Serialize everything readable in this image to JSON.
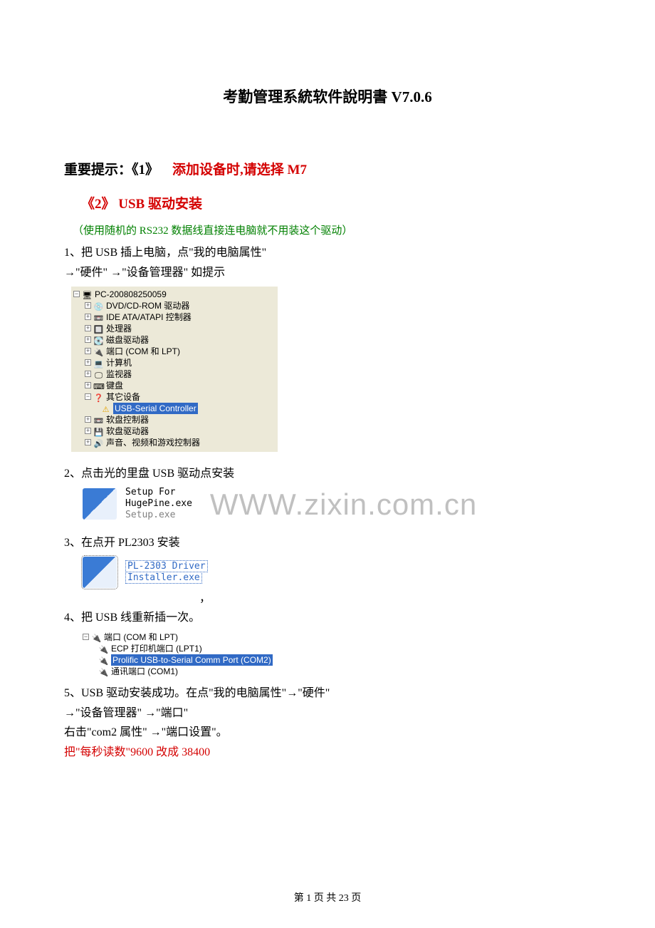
{
  "title": "考勤管理系統软件說明書 V7.0.6",
  "important_prefix": "重要提示：《1》",
  "important_rest": "添加设备时,请选择 M7",
  "sub2_num": "《2》",
  "sub2_rest": "USB 驱动安装",
  "green_note": "（使用随机的 RS232 数据线直接连电脑就不用装这个驱动）",
  "step1_a": "1、把 USB 插上电脑，点\"我的电脑属性\"",
  "step1_b": "→\"硬件\" →\"设备管理器\"  如提示",
  "devmgr": {
    "root": "PC-200808250059",
    "items": [
      "DVD/CD-ROM 驱动器",
      "IDE ATA/ATAPI 控制器",
      "处理器",
      "磁盘驱动器",
      "端口 (COM 和 LPT)",
      "计算机",
      "监视器",
      "键盘"
    ],
    "other_devices": "其它设备",
    "usb_serial": "USB-Serial Controller",
    "tail": [
      "软盘控制器",
      "软盘驱动器",
      "声音、视频和游戏控制器"
    ]
  },
  "step2_line": " 2、点击光的里盘 USB  驱动点安装",
  "setup1": {
    "l1": "Setup For",
    "l2": "HugePine.exe",
    "l3": "Setup.exe"
  },
  "step3_line": "3、在点开 PL2303 安装",
  "setup2": {
    "l1": "PL-2303 Driver",
    "l2": "Installer.exe"
  },
  "comma": "，",
  "step4_line": "4、把 USB 线重新插一次。",
  "ports": {
    "root": "端口 (COM 和 LPT)",
    "p1": "ECP 打印机端口 (LPT1)",
    "p2": "Prolific USB-to-Serial Comm Port (COM2)",
    "p3": "通讯端口 (COM1)"
  },
  "step5_a": "5、USB 驱动安装成功。在点\"我的电脑属性\"→\"硬件\"",
  "step5_b": " →\"设备管理器\"  →\"端口\"",
  "step5_c": "右击\"com2 属性\" →\"端口设置\"。",
  "step5_d": "把\"每秒读数\"9600 改成 38400",
  "watermark": "WWW.zixin.com.cn",
  "footer": "第 1 页 共 23 页"
}
